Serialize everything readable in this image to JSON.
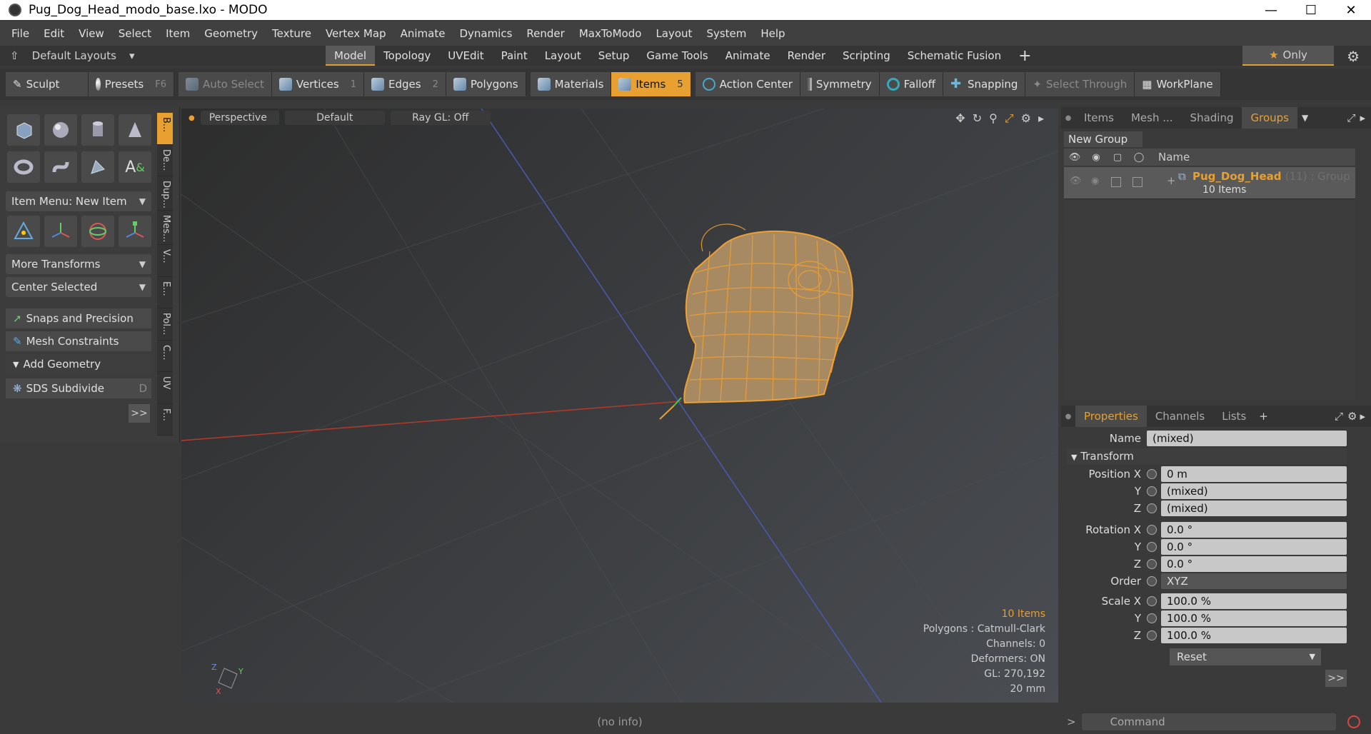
{
  "window": {
    "title": "Pug_Dog_Head_modo_base.lxo - MODO"
  },
  "menu": [
    "File",
    "Edit",
    "View",
    "Select",
    "Item",
    "Geometry",
    "Texture",
    "Vertex Map",
    "Animate",
    "Dynamics",
    "Render",
    "MaxToModo",
    "Layout",
    "System",
    "Help"
  ],
  "tabbar": {
    "layouts_label": "Default Layouts",
    "tabs": [
      "Model",
      "Topology",
      "UVEdit",
      "Paint",
      "Layout",
      "Setup",
      "Game Tools",
      "Animate",
      "Render",
      "Scripting",
      "Schematic Fusion"
    ],
    "active_tab": "Model",
    "only_label": "Only"
  },
  "toolbar": {
    "sculpt": "Sculpt",
    "presets": "Presets",
    "presets_key": "F6",
    "auto_select": "Auto Select",
    "vertices": "Vertices",
    "vertices_key": "1",
    "edges": "Edges",
    "edges_key": "2",
    "polygons": "Polygons",
    "materials": "Materials",
    "items": "Items",
    "items_key": "5",
    "action_center": "Action Center",
    "symmetry": "Symmetry",
    "falloff": "Falloff",
    "snapping": "Snapping",
    "select_through": "Select Through",
    "workplane": "WorkPlane"
  },
  "left": {
    "item_menu": "Item Menu: New Item",
    "more_transforms": "More Transforms",
    "center_selected": "Center Selected",
    "snaps": "Snaps and Precision",
    "mesh_constraints": "Mesh Constraints",
    "add_geometry": "Add Geometry",
    "sds_subdivide": "SDS Subdivide",
    "sds_key": "D",
    "more": ">>",
    "vtabs": [
      "B...",
      "De...",
      "Dup...",
      "Mes...",
      "V...",
      "E...",
      "Pol...",
      "C...",
      "UV",
      "F..."
    ]
  },
  "viewport": {
    "view": "Perspective",
    "shading": "Default",
    "raygl": "Ray GL: Off",
    "stats": {
      "items": "10 Items",
      "polygons": "Polygons : Catmull-Clark",
      "channels": "Channels: 0",
      "deformers": "Deformers: ON",
      "gl": "GL: 270,192",
      "scale": "20 mm"
    },
    "no_info": "(no info)"
  },
  "groups_panel": {
    "tabs": [
      "Items",
      "Mesh ...",
      "Shading",
      "Groups"
    ],
    "new_group": "New Group",
    "name_header": "Name",
    "group_name": "Pug_Dog_Head",
    "group_suffix": "(11) : Group",
    "group_items": "10 Items"
  },
  "properties": {
    "tabs": [
      "Properties",
      "Channels",
      "Lists"
    ],
    "name_label": "Name",
    "name_value": "(mixed)",
    "transform_label": "Transform",
    "position": [
      {
        "axis": "Position X",
        "value": "0 m"
      },
      {
        "axis": "Y",
        "value": "(mixed)"
      },
      {
        "axis": "Z",
        "value": "(mixed)"
      }
    ],
    "rotation": [
      {
        "axis": "Rotation X",
        "value": "0.0 °"
      },
      {
        "axis": "Y",
        "value": "0.0 °"
      },
      {
        "axis": "Z",
        "value": "0.0 °"
      }
    ],
    "order_label": "Order",
    "order_value": "XYZ",
    "scale": [
      {
        "axis": "Scale X",
        "value": "100.0 %"
      },
      {
        "axis": "Y",
        "value": "100.0 %"
      },
      {
        "axis": "Z",
        "value": "100.0 %"
      }
    ],
    "reset": "Reset",
    "more": ">>"
  },
  "command": {
    "placeholder": "Command",
    "prompt": ">"
  },
  "colors": {
    "accent": "#e8a030",
    "background": "#3a3a3a",
    "mesh": "#f0a030"
  }
}
